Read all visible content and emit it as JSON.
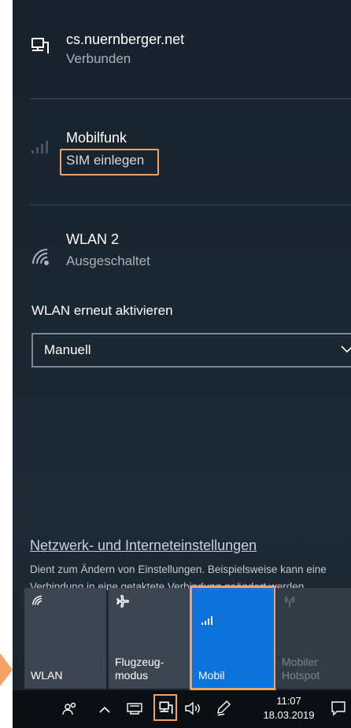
{
  "networks": [
    {
      "name": "cs.nuernberger.net",
      "status": "Verbunden",
      "icon": "ethernet-icon"
    },
    {
      "name": "Mobilfunk",
      "status": "SIM einlegen",
      "icon": "cellular-signal-icon"
    },
    {
      "name": "WLAN 2",
      "status": "Ausgeschaltet",
      "icon": "wifi-icon"
    }
  ],
  "wlan_reactivate": {
    "label": "WLAN erneut aktivieren",
    "selected": "Manuell"
  },
  "settings": {
    "link": "Netzwerk- und Interneteinstellungen",
    "desc_line1": "Dient zum Ändern von Einstellungen. Beispielsweise kann eine",
    "desc_line2": "Verbindung in eine getaktete Verbindung geändert werden."
  },
  "quick_actions": [
    {
      "label": "WLAN",
      "icon": "wifi-icon",
      "state": "off"
    },
    {
      "label": "Flugzeug-\nmodus",
      "icon": "airplane-icon",
      "state": "off"
    },
    {
      "label": "Mobil",
      "icon": "cellular-signal-icon",
      "state": "on"
    },
    {
      "label": "Mobiler\nHotspot",
      "icon": "hotspot-icon",
      "state": "disabled"
    }
  ],
  "taskbar": {
    "time": "11:07",
    "date": "18.03.2019"
  },
  "colors": {
    "accent": "#0d72d9",
    "highlight": "#f4a266",
    "panel": "#1a2630"
  }
}
